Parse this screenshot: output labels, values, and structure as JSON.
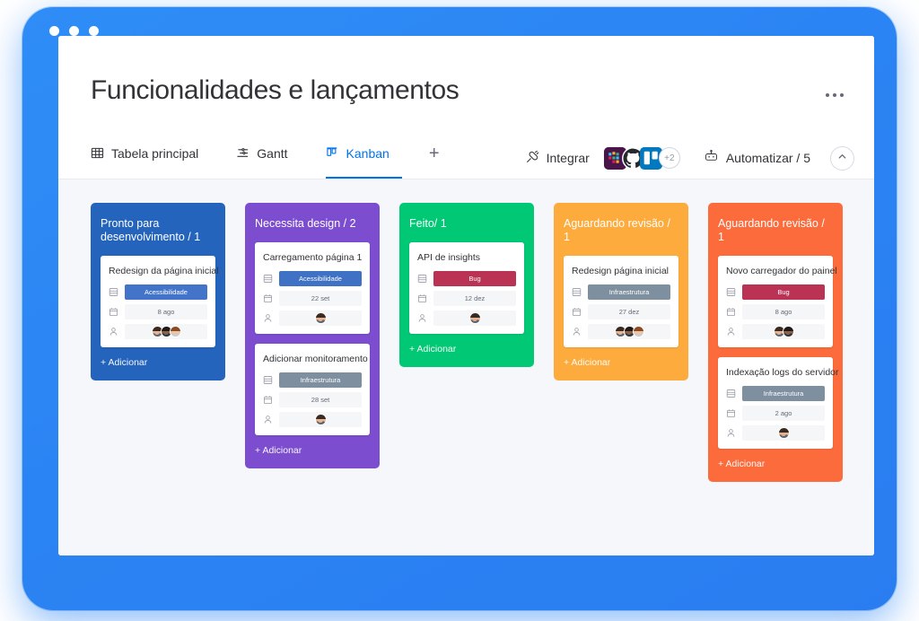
{
  "window": {
    "dots": [
      "close-dot",
      "minimize-dot",
      "maximize-dot"
    ],
    "frame_color": "#2d87f6"
  },
  "header": {
    "title": "Funcionalidades e lançamentos",
    "more_menu": "…"
  },
  "tabs": [
    {
      "label": "Tabela principal",
      "icon": "table-icon",
      "active": false
    },
    {
      "label": "Gantt",
      "icon": "gantt-icon",
      "active": false
    },
    {
      "label": "Kanban",
      "icon": "kanban-icon",
      "active": true
    }
  ],
  "tab_add_label": "+",
  "toolbar": {
    "integrate_label": "Integrar",
    "integrate_icon": "plug-icon",
    "integrations": [
      "slack-icon",
      "github-icon",
      "trello-icon"
    ],
    "integrations_more": "+2",
    "automate_label": "Automatizar / 5",
    "automate_icon": "robot-icon",
    "collapse_icon": "chevron-up-icon"
  },
  "board": {
    "add_label": "+ Adicionar",
    "columns": [
      {
        "title": "Pronto para desenvolvimento / 1",
        "color": "#2564bd",
        "cards": [
          {
            "title": "Redesign da página inicial",
            "status": "Acessibilidade",
            "status_color": "#4374c9",
            "date": "8 ago",
            "people": 3
          }
        ]
      },
      {
        "title": "Necessita design / 2",
        "color": "#7c4dcf",
        "cards": [
          {
            "title": "Carregamento página 1",
            "status": "Acessibilidade",
            "status_color": "#3f71c4",
            "date": "22 set",
            "people": 1
          },
          {
            "title": "Adicionar monitoramento",
            "status": "Infraestrutura",
            "status_color": "#7e8fa0",
            "date": "28 set",
            "people": 1
          }
        ]
      },
      {
        "title": "Feito/ 1",
        "color": "#00c875",
        "cards": [
          {
            "title": "API de insights",
            "status": "Bug",
            "status_color": "#bb3354",
            "date": "12 dez",
            "people": 1
          }
        ]
      },
      {
        "title": "Aguardando revisão / 1",
        "color": "#fdab3d",
        "cards": [
          {
            "title": "Redesign página inicial",
            "status": "Infraestrutura",
            "status_color": "#7e8fa0",
            "date": "27 dez",
            "people": 3
          }
        ]
      },
      {
        "title": "Aguardando revisão / 1",
        "color": "#fb6b3c",
        "cards": [
          {
            "title": "Novo carregador do painel",
            "status": "Bug",
            "status_color": "#bb3354",
            "date": "8 ago",
            "people": 2
          },
          {
            "title": "Indexação logs do servidor",
            "status": "Infraestrutura",
            "status_color": "#7e8fa0",
            "date": "2 ago",
            "people": 1
          }
        ]
      }
    ],
    "row_icons": [
      "status-rows-icon",
      "calendar-icon",
      "person-icon"
    ]
  }
}
